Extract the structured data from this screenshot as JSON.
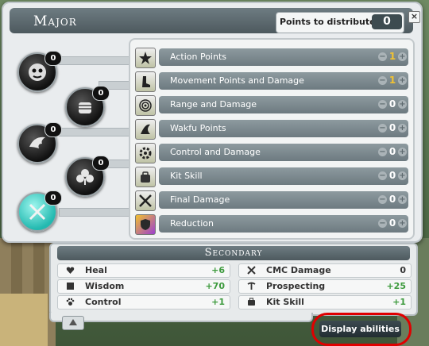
{
  "window": {
    "title": "Major",
    "points_label": "Points to distribute:",
    "points_value": "0",
    "close_label": "×"
  },
  "branches": [
    {
      "name": "intelligence",
      "count": "0"
    },
    {
      "name": "strength",
      "count": "0"
    },
    {
      "name": "agility",
      "count": "0"
    },
    {
      "name": "chance",
      "count": "0"
    },
    {
      "name": "major",
      "count": "0"
    }
  ],
  "major": {
    "items": [
      {
        "label": "Action Points",
        "value": "1",
        "minus": "−",
        "plus": "+"
      },
      {
        "label": "Movement Points and Damage",
        "value": "1",
        "minus": "−",
        "plus": "+"
      },
      {
        "label": "Range and Damage",
        "value": "0",
        "minus": "−",
        "plus": "+"
      },
      {
        "label": "Wakfu Points",
        "value": "0",
        "minus": "−",
        "plus": "+"
      },
      {
        "label": "Control and Damage",
        "value": "0",
        "minus": "−",
        "plus": "+"
      },
      {
        "label": "Kit Skill",
        "value": "0",
        "minus": "−",
        "plus": "+"
      },
      {
        "label": "Final Damage",
        "value": "0",
        "minus": "−",
        "plus": "+"
      },
      {
        "label": "Reduction",
        "value": "0",
        "minus": "−",
        "plus": "+"
      }
    ]
  },
  "secondary": {
    "title": "Secondary",
    "items": [
      {
        "label": "Heal",
        "value": "+6"
      },
      {
        "label": "CMC Damage",
        "value": "0"
      },
      {
        "label": "Wisdom",
        "value": "+70"
      },
      {
        "label": "Prospecting",
        "value": "+25"
      },
      {
        "label": "Control",
        "value": "+1"
      },
      {
        "label": "Kit Skill",
        "value": "+1"
      }
    ]
  },
  "footer": {
    "display_abilities": "Display abilities"
  },
  "colors": {
    "accent_value": "#f1c232",
    "positive": "#3d9a3d",
    "highlight_ring": "#e00000"
  }
}
